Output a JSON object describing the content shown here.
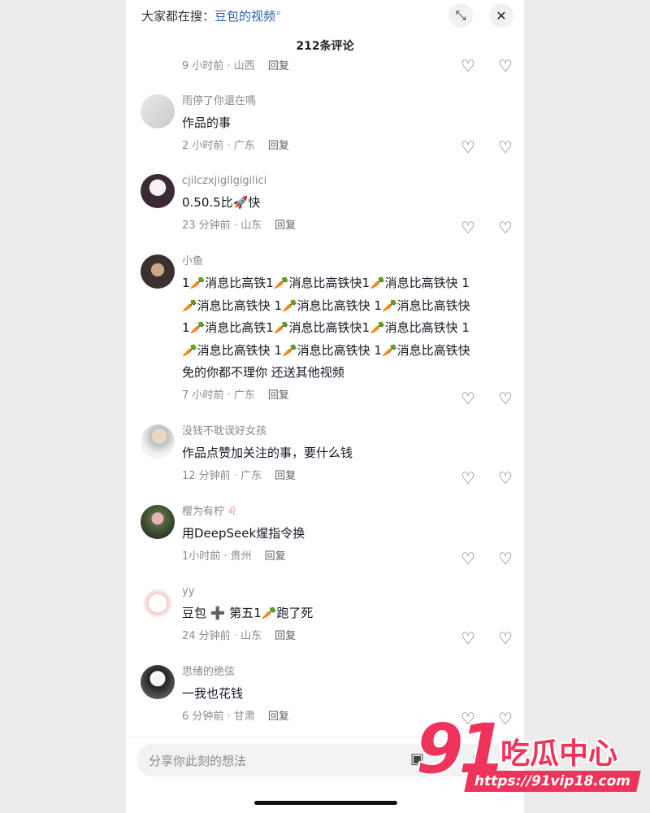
{
  "search": {
    "prefix": "大家都在搜：",
    "keyword": "豆包的视频"
  },
  "header": {
    "comment_count": "212条评论",
    "minimize_icon": "minimize-icon",
    "close_icon": "close-icon"
  },
  "partial_comment": {
    "time": "9 小时前 · 山西",
    "reply": "回复"
  },
  "comments": [
    {
      "username": "雨停了你還在嗎",
      "text": "作品的事",
      "time": "2 小时前 · 广东",
      "reply": "回复"
    },
    {
      "username": "cjilczxjiglIgigilici",
      "text": "0.50.5比🚀快",
      "time": "23 分钟前 · 山东",
      "reply": "回复"
    },
    {
      "username": "小鱼",
      "text": "1🥕消息比高铁1🥕消息比高铁快1🥕消息比高铁快 1\n🥕消息比高铁快 1🥕消息比高铁快 1🥕消息比高铁快\n1🥕消息比高铁1🥕消息比高铁快1🥕消息比高铁快 1\n🥕消息比高铁快 1🥕消息比高铁快 1🥕消息比高铁快\n免的你都不理你 还送其他视频",
      "time": "7 小时前 · 广东",
      "reply": "回复"
    },
    {
      "username": "没钱不耽误好女孩",
      "text": "作品点赞加关注的事，要什么钱",
      "time": "12 分钟前 · 广东",
      "reply": "回复"
    },
    {
      "username": "樱为有柠",
      "badge": "♌",
      "text": "用DeepSeek煋指令换",
      "time": "1小时前 · 贵州",
      "reply": "回复"
    },
    {
      "username": "yy",
      "text": "豆包 ➕ 第五1🥕跑了死",
      "time": "24 分钟前 · 山东",
      "reply": "回复"
    },
    {
      "username": "思绪的绝弦",
      "text": "一我也花钱",
      "time": "6 分钟前 · 甘肃",
      "reply": "回复"
    }
  ],
  "input": {
    "placeholder": "分享你此刻的想法",
    "image_icon": "image-icon",
    "emoji_icon": "emoji-icon"
  },
  "watermark": {
    "number": "91",
    "name": "吃瓜中心",
    "url": "https://91vip18.com"
  },
  "icons": {
    "like": "heart-icon",
    "dislike": "broken-heart-icon"
  },
  "colors": {
    "keyword": "#2b5fa8",
    "watermark": "#f0335b"
  }
}
